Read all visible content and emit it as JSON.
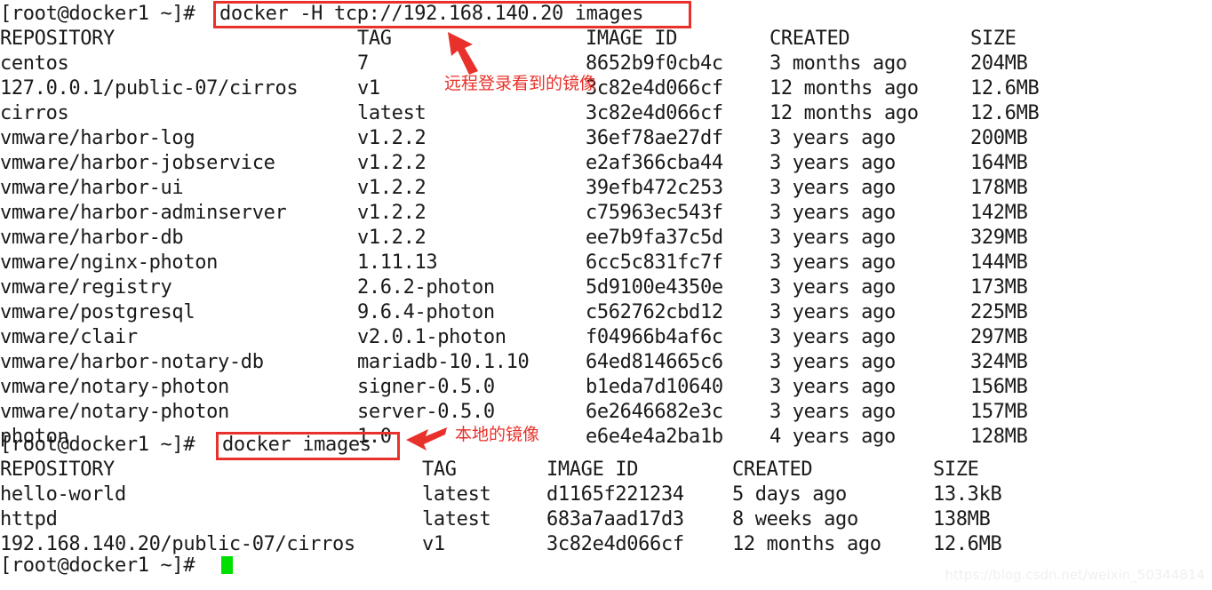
{
  "terminal": {
    "prompt": "[root@docker1 ~]#",
    "commands": {
      "remote": "docker -H tcp://192.168.140.20 images",
      "local": "docker images"
    },
    "cursor": "block-cursor"
  },
  "annotations": {
    "remote_note": "远程登录看到的镜像",
    "local_note": "本地的镜像",
    "box_color": "#e8312a",
    "arrow_remote": "arrow-up-left-icon",
    "arrow_local": "arrow-left-icon"
  },
  "remote_table": {
    "headers": {
      "repository": "REPOSITORY",
      "tag": "TAG",
      "image_id": "IMAGE ID",
      "created": "CREATED",
      "size": "SIZE"
    },
    "rows": [
      {
        "repository": "centos",
        "tag": "7",
        "image_id": "8652b9f0cb4c",
        "created": "3 months ago",
        "size": "204MB"
      },
      {
        "repository": "127.0.0.1/public-07/cirros",
        "tag": "v1",
        "image_id": "3c82e4d066cf",
        "created": "12 months ago",
        "size": "12.6MB"
      },
      {
        "repository": "cirros",
        "tag": "latest",
        "image_id": "3c82e4d066cf",
        "created": "12 months ago",
        "size": "12.6MB"
      },
      {
        "repository": "vmware/harbor-log",
        "tag": "v1.2.2",
        "image_id": "36ef78ae27df",
        "created": "3 years ago",
        "size": "200MB"
      },
      {
        "repository": "vmware/harbor-jobservice",
        "tag": "v1.2.2",
        "image_id": "e2af366cba44",
        "created": "3 years ago",
        "size": "164MB"
      },
      {
        "repository": "vmware/harbor-ui",
        "tag": "v1.2.2",
        "image_id": "39efb472c253",
        "created": "3 years ago",
        "size": "178MB"
      },
      {
        "repository": "vmware/harbor-adminserver",
        "tag": "v1.2.2",
        "image_id": "c75963ec543f",
        "created": "3 years ago",
        "size": "142MB"
      },
      {
        "repository": "vmware/harbor-db",
        "tag": "v1.2.2",
        "image_id": "ee7b9fa37c5d",
        "created": "3 years ago",
        "size": "329MB"
      },
      {
        "repository": "vmware/nginx-photon",
        "tag": "1.11.13",
        "image_id": "6cc5c831fc7f",
        "created": "3 years ago",
        "size": "144MB"
      },
      {
        "repository": "vmware/registry",
        "tag": "2.6.2-photon",
        "image_id": "5d9100e4350e",
        "created": "3 years ago",
        "size": "173MB"
      },
      {
        "repository": "vmware/postgresql",
        "tag": "9.6.4-photon",
        "image_id": "c562762cbd12",
        "created": "3 years ago",
        "size": "225MB"
      },
      {
        "repository": "vmware/clair",
        "tag": "v2.0.1-photon",
        "image_id": "f04966b4af6c",
        "created": "3 years ago",
        "size": "297MB"
      },
      {
        "repository": "vmware/harbor-notary-db",
        "tag": "mariadb-10.1.10",
        "image_id": "64ed814665c6",
        "created": "3 years ago",
        "size": "324MB"
      },
      {
        "repository": "vmware/notary-photon",
        "tag": "signer-0.5.0",
        "image_id": "b1eda7d10640",
        "created": "3 years ago",
        "size": "156MB"
      },
      {
        "repository": "vmware/notary-photon",
        "tag": "server-0.5.0",
        "image_id": "6e2646682e3c",
        "created": "3 years ago",
        "size": "157MB"
      },
      {
        "repository": "photon",
        "tag": "1.0",
        "image_id": "e6e4e4a2ba1b",
        "created": "4 years ago",
        "size": "128MB"
      }
    ]
  },
  "local_table": {
    "headers": {
      "repository": "REPOSITORY",
      "tag": "TAG",
      "image_id": "IMAGE ID",
      "created": "CREATED",
      "size": "SIZE"
    },
    "rows": [
      {
        "repository": "hello-world",
        "tag": "latest",
        "image_id": "d1165f221234",
        "created": "5 days ago",
        "size": "13.3kB"
      },
      {
        "repository": "httpd",
        "tag": "latest",
        "image_id": "683a7aad17d3",
        "created": "8 weeks ago",
        "size": "138MB"
      },
      {
        "repository": "192.168.140.20/public-07/cirros",
        "tag": "v1",
        "image_id": "3c82e4d066cf",
        "created": "12 months ago",
        "size": "12.6MB"
      }
    ]
  },
  "watermark": "https://blog.csdn.net/weixin_50344814"
}
